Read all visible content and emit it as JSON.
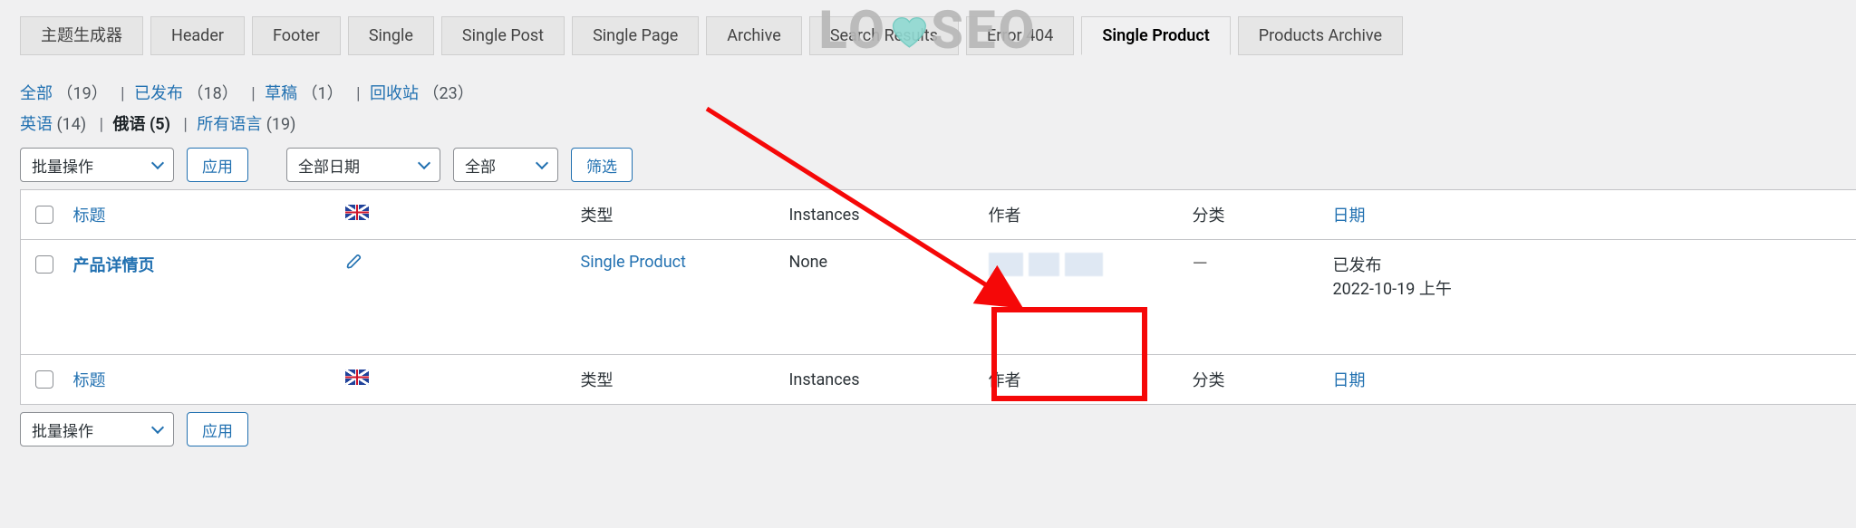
{
  "tabs": [
    {
      "label": "主题生成器",
      "active": false
    },
    {
      "label": "Header",
      "active": false
    },
    {
      "label": "Footer",
      "active": false
    },
    {
      "label": "Single",
      "active": false
    },
    {
      "label": "Single Post",
      "active": false
    },
    {
      "label": "Single Page",
      "active": false
    },
    {
      "label": "Archive",
      "active": false
    },
    {
      "label": "Search Results",
      "active": false
    },
    {
      "label": "Error 404",
      "active": false
    },
    {
      "label": "Single Product",
      "active": true
    },
    {
      "label": "Products Archive",
      "active": false
    }
  ],
  "status_filters": {
    "all": {
      "label": "全部",
      "count": "（19）"
    },
    "published": {
      "label": "已发布",
      "count": "（18）"
    },
    "draft": {
      "label": "草稿",
      "count": "（1）"
    },
    "trash": {
      "label": "回收站",
      "count": "（23）"
    }
  },
  "lang_filters": {
    "en": {
      "label": "英语",
      "count": "(14)"
    },
    "ru": {
      "label": "俄语",
      "count": "(5)",
      "current": true
    },
    "all": {
      "label": "所有语言",
      "count": "(19)"
    }
  },
  "bulk": {
    "bulk_action_label": "批量操作",
    "apply_label": "应用",
    "date_filter_label": "全部日期",
    "cat_filter_label": "全部",
    "filter_button_label": "筛选"
  },
  "columns": {
    "title": "标题",
    "type": "类型",
    "instances": "Instances",
    "author": "作者",
    "category": "分类",
    "date": "日期"
  },
  "rows": [
    {
      "title": "产品详情页",
      "type": "Single Product",
      "instances": "None",
      "category": "—",
      "date_status": "已发布",
      "date_value": "2022-10-19 上午"
    }
  ],
  "watermark": {
    "left": "LO",
    "right": "SEO"
  }
}
